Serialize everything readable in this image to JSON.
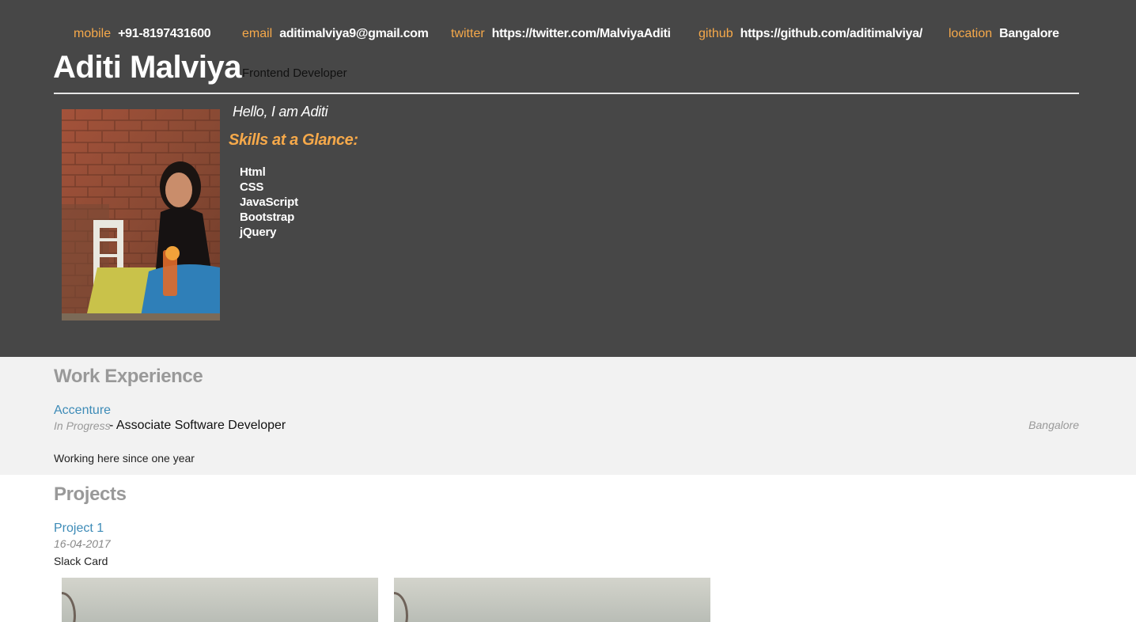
{
  "header": {
    "contacts": [
      {
        "label": "mobile",
        "value": "+91-8197431600"
      },
      {
        "label": "email",
        "value": "aditimalviya9@gmail.com"
      },
      {
        "label": "twitter",
        "value": "https://twitter.com/MalviyaAditi"
      },
      {
        "label": "github",
        "value": "https://github.com/aditimalviya/"
      },
      {
        "label": "location",
        "value": "Bangalore"
      }
    ],
    "name": "Aditi Malviya",
    "role": "Frontend Developer"
  },
  "about": {
    "hello": "Hello, I am Aditi",
    "skills_title": "Skills at a Glance:",
    "skills": [
      "Html",
      "CSS",
      "JavaScript",
      "Bootstrap",
      "jQuery"
    ]
  },
  "work": {
    "title": "Work Experience",
    "company": "Accenture",
    "status": "In Progress",
    "job_title": "- Associate Software Developer",
    "location": "Bangalore",
    "description": "Working here since one year"
  },
  "projects": {
    "title": "Projects",
    "items": [
      {
        "name": "Project 1",
        "date": "16-04-2017",
        "description": "Slack Card"
      }
    ]
  },
  "colors": {
    "header_bg": "#474747",
    "accent": "#f6a94a",
    "link": "#3d8bb7",
    "section_bg": "#f2f2f2",
    "muted": "#999999"
  }
}
